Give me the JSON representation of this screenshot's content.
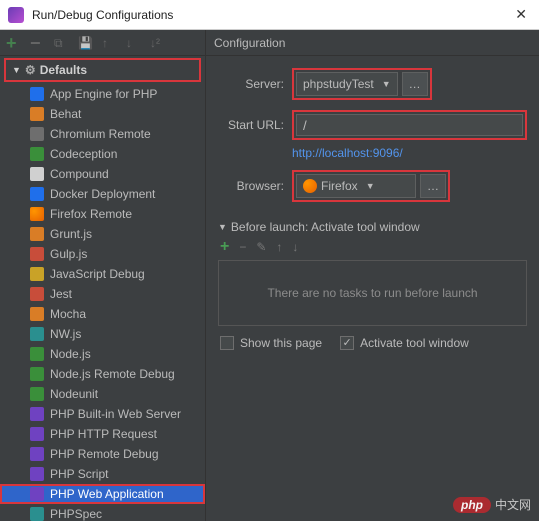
{
  "window": {
    "title": "Run/Debug Configurations"
  },
  "tree": {
    "group": "Defaults",
    "items": [
      {
        "label": "App Engine for PHP",
        "iconClass": "ico-blue"
      },
      {
        "label": "Behat",
        "iconClass": "ico-orange"
      },
      {
        "label": "Chromium Remote",
        "iconClass": "ico-gray"
      },
      {
        "label": "Codeception",
        "iconClass": "ico-green"
      },
      {
        "label": "Compound",
        "iconClass": "ico-folder"
      },
      {
        "label": "Docker Deployment",
        "iconClass": "ico-blue"
      },
      {
        "label": "Firefox Remote",
        "iconClass": "ico-firefox"
      },
      {
        "label": "Grunt.js",
        "iconClass": "ico-orange"
      },
      {
        "label": "Gulp.js",
        "iconClass": "ico-red"
      },
      {
        "label": "JavaScript Debug",
        "iconClass": "ico-yellow"
      },
      {
        "label": "Jest",
        "iconClass": "ico-red"
      },
      {
        "label": "Mocha",
        "iconClass": "ico-orange"
      },
      {
        "label": "NW.js",
        "iconClass": "ico-teal"
      },
      {
        "label": "Node.js",
        "iconClass": "ico-green"
      },
      {
        "label": "Node.js Remote Debug",
        "iconClass": "ico-green"
      },
      {
        "label": "Nodeunit",
        "iconClass": "ico-green"
      },
      {
        "label": "PHP Built-in Web Server",
        "iconClass": "ico-purple"
      },
      {
        "label": "PHP HTTP Request",
        "iconClass": "ico-purple"
      },
      {
        "label": "PHP Remote Debug",
        "iconClass": "ico-purple"
      },
      {
        "label": "PHP Script",
        "iconClass": "ico-purple"
      },
      {
        "label": "PHP Web Application",
        "iconClass": "ico-purple",
        "selected": true
      },
      {
        "label": "PHPSpec",
        "iconClass": "ico-teal"
      }
    ]
  },
  "config": {
    "heading": "Configuration",
    "serverLabel": "Server:",
    "serverValue": "phpstudyTest",
    "startUrlLabel": "Start URL:",
    "startUrlValue": "/",
    "resolvedUrl": "http://localhost:9096/",
    "browserLabel": "Browser:",
    "browserValue": "Firefox"
  },
  "before": {
    "heading": "Before launch: Activate tool window",
    "emptyText": "There are no tasks to run before launch"
  },
  "footer": {
    "showThisPage": "Show this page",
    "activateToolWindow": "Activate tool window"
  },
  "brand": {
    "pill": "php",
    "text": "中文网"
  }
}
